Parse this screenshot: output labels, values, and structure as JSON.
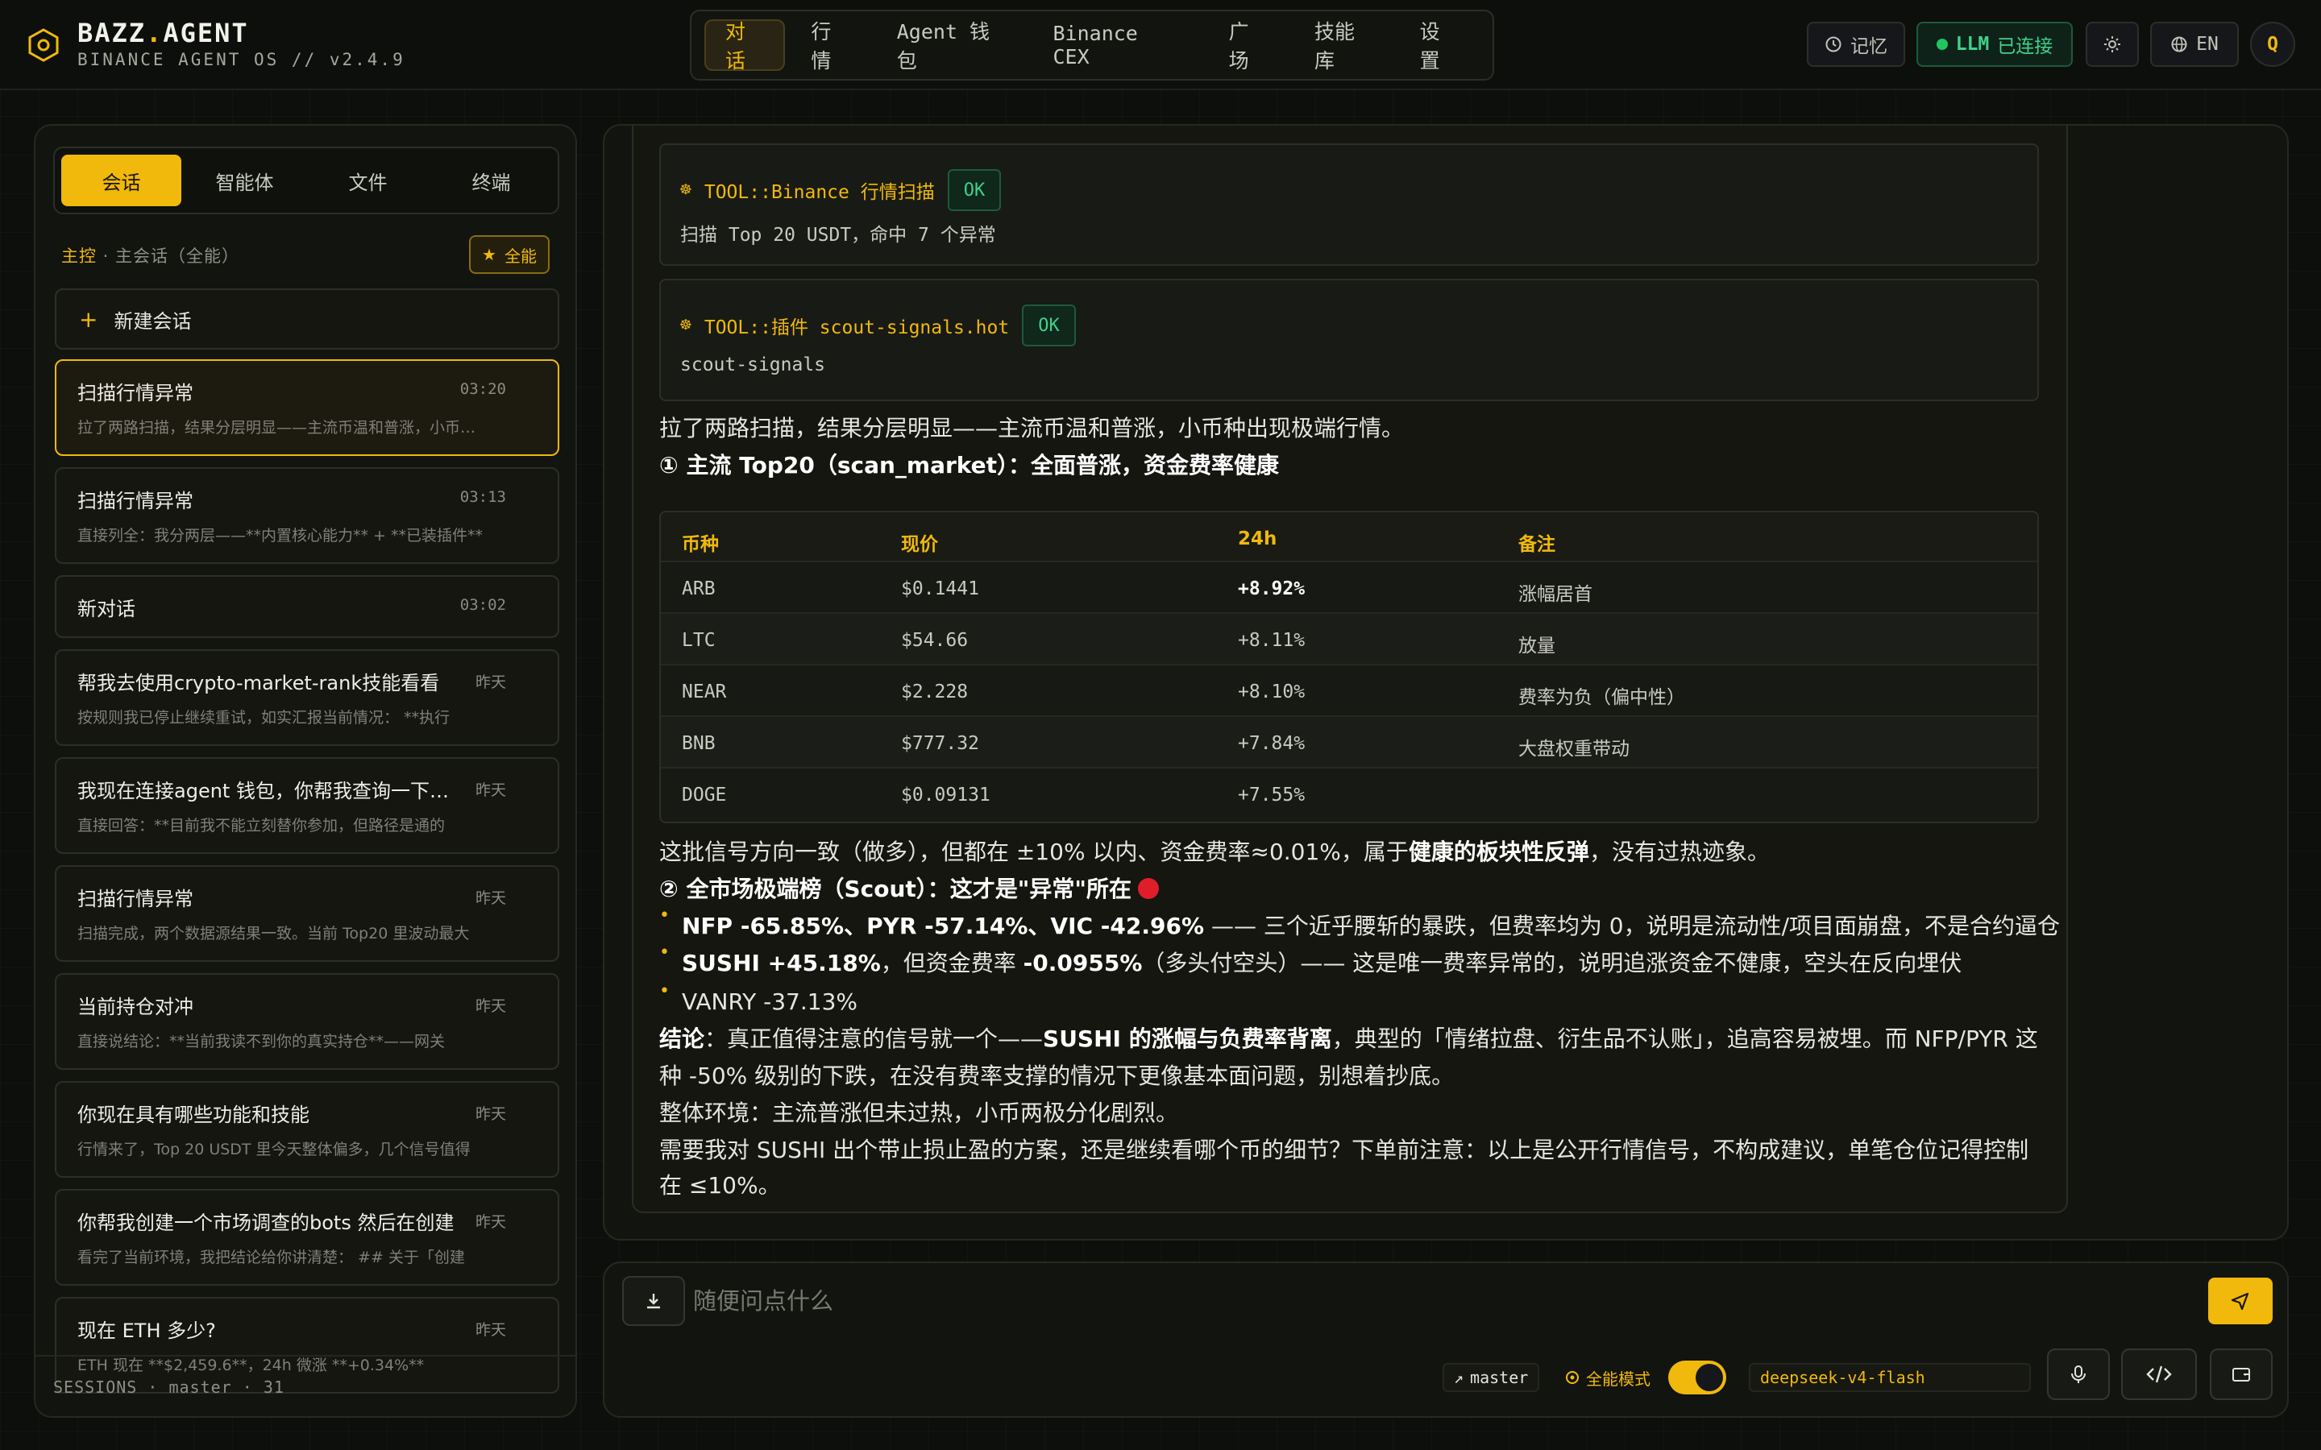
{
  "brand": {
    "name_part1": "BAZZ",
    "name_dot": ".",
    "name_part2": "AGENT",
    "subtitle": "BINANCE AGENT OS // v2.4.9"
  },
  "nav": [
    {
      "label": "对话",
      "active": true
    },
    {
      "label": "行情"
    },
    {
      "label": "Agent 钱包"
    },
    {
      "label": "Binance CEX"
    },
    {
      "label": "广场"
    },
    {
      "label": "技能库"
    },
    {
      "label": "设置"
    }
  ],
  "header": {
    "memory_label": "记忆",
    "llm_label": "LLM",
    "llm_status": "已连接",
    "lang_label": "EN",
    "user_initial": "Q"
  },
  "sidebar": {
    "tabs": [
      "会话",
      "智能体",
      "文件",
      "终端"
    ],
    "control_key": "主控",
    "control_text": " · 主会话（全能）",
    "all_badge": "全能",
    "new_chat": "新建会话",
    "footer": "SESSIONS · master · 31",
    "sessions": [
      {
        "title": "扫描行情异常",
        "time": "03:20",
        "preview": "拉了两路扫描，结果分层明显——主流币温和普涨，小币种出现极端行情。",
        "active": true
      },
      {
        "title": "扫描行情异常",
        "time": "03:13",
        "preview": "直接列全：我分两层——**内置核心能力** + **已装插件**"
      },
      {
        "title": "新对话",
        "time": "03:02",
        "preview": ""
      },
      {
        "title": "帮我去使用crypto-market-rank技能看看",
        "time": "昨天",
        "preview": "按规则我已停止继续重试，如实汇报当前情况：  **执行"
      },
      {
        "title": "我现在连接agent 钱包，你帮我查询一下它的余额",
        "time": "昨天",
        "preview": "直接回答：**目前我不能立刻替你参加，但路径是通的"
      },
      {
        "title": "扫描行情异常",
        "time": "昨天",
        "preview": "扫描完成，两个数据源结果一致。当前 Top20 里波动最大"
      },
      {
        "title": "当前持仓对冲",
        "time": "昨天",
        "preview": "直接说结论：**当前我读不到你的真实持仓**——网关"
      },
      {
        "title": "你现在具有哪些功能和技能",
        "time": "昨天",
        "preview": "行情来了，Top 20 USDT 里今天整体偏多，几个信号值得"
      },
      {
        "title": "你帮我创建一个市场调查的bots 然后在创建",
        "time": "昨天",
        "preview": "看完了当前环境，我把结论给你讲清楚：  ## 关于「创建"
      },
      {
        "title": "现在 ETH 多少?",
        "time": "昨天",
        "preview": "ETH 现在 **$2,459.6**，24h 微涨 **+0.34%**"
      }
    ]
  },
  "chat": {
    "tool1": {
      "icon": "gear-icon",
      "name": "TOOL::Binance 行情扫描",
      "status": "OK",
      "result": "扫描 Top 20 USDT，命中 7 个异常"
    },
    "tool2": {
      "icon": "gear-icon",
      "name": "TOOL::插件 scout-signals.hot",
      "status": "OK",
      "result": "scout-signals"
    },
    "intro": "拉了两路扫描，结果分层明显——主流币温和普涨，小币种出现极端行情。",
    "section1": "① 主流 Top20（scan_market）：全面普涨，资金费率健康",
    "table": {
      "headers": [
        "币种",
        "现价",
        "24h",
        "备注"
      ],
      "rows": [
        [
          "ARB",
          "$0.1441",
          "+8.92%",
          "涨幅居首"
        ],
        [
          "LTC",
          "$54.66",
          "+8.11%",
          "放量"
        ],
        [
          "NEAR",
          "$2.228",
          "+8.10%",
          "费率为负（偏中性）"
        ],
        [
          "BNB",
          "$777.32",
          "+7.84%",
          "大盘权重带动"
        ],
        [
          "DOGE",
          "$0.09131",
          "+7.55%",
          ""
        ]
      ]
    },
    "p1_a": "这批信号方向一致（做多），但都在 ±10% 以内、资金费率≈0.01%，属于",
    "p1_b": "健康的板块性反弹",
    "p1_c": "，没有过热迹象。",
    "section2": "② 全市场极端榜（Scout）：这才是\"异常\"所在",
    "b1_bold": "NFP -65.85%、PYR -57.14%、VIC -42.96%",
    "b1_rest": " —— 三个近乎腰斩的暴跌，但费率均为 0，说明是流动性/项目面崩盘，不是合约逼仓",
    "b2_bold1": "SUSHI +45.18%",
    "b2_mid": "，但资金费率 ",
    "b2_bold2": "-0.0955%",
    "b2_rest": "（多头付空头）—— 这是唯一费率异常的，说明追涨资金不健康，空头在反向埋伏",
    "b3": "VANRY -37.13%",
    "c_label": "结论",
    "c_a": "：真正值得注意的信号就一个——",
    "c_bold": "SUSHI 的涨幅与负费率背离",
    "c_b": "，典型的「情绪拉盘、衍生品不认账」，追高容易被埋。而 NFP/PYR 这",
    "c_line2": "种 -50% 级别的下跌，在没有费率支撑的情况下更像基本面问题，别想着抄底。",
    "env": "整体环境：主流普涨但未过热，小币两极分化剧烈。",
    "q_line1": "需要我对 SUSHI 出个带止损止盈的方案，还是继续看哪个币的细节？下单前注意：以上是公开行情信号，不构成建议，单笔仓位记得控制",
    "q_line2": "在 ≤10%。"
  },
  "composer": {
    "placeholder": "随便问点什么",
    "branch": "master",
    "mode_label": "全能模式",
    "model": "deepseek-v4-flash"
  },
  "colors": {
    "accent": "#f0b90b",
    "ok": "#3fd28a",
    "bg": "#0d0f0c",
    "alert": "#e11d2a"
  }
}
